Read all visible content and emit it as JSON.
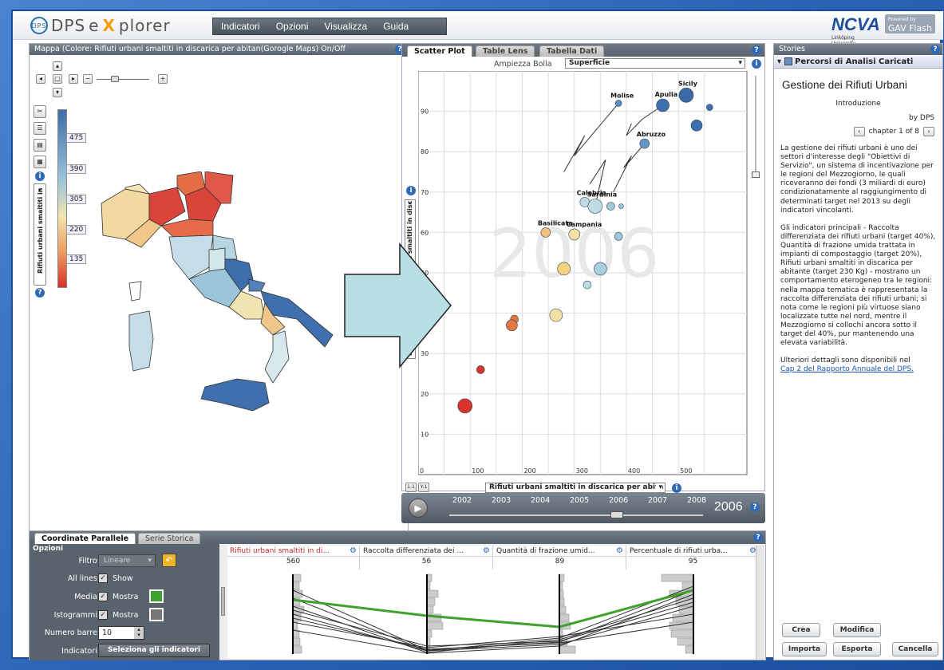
{
  "header": {
    "logo_prefix": "DPS",
    "logo_e": "e",
    "logo_x": "X",
    "logo_rest": "plorer",
    "menu": [
      "Indicatori",
      "Opzioni",
      "Visualizza",
      "Guida"
    ],
    "ncva": "NCVA",
    "ncva_sub": "Linköping University",
    "powered": "Powered by",
    "gav": "GAV Flash"
  },
  "map": {
    "title": "Mappa (Colore: Rifiuti urbani smaltiti in discarica per abitan(Gorogle Maps) On/Off",
    "legend_ticks": [
      "475",
      "390",
      "305",
      "220",
      "135"
    ],
    "legend_label": "Rifiuti urbani smaltiti in",
    "colors": {
      "high": "#3d6eaa",
      "mid": "#f2e4b0",
      "low": "#d7302a"
    }
  },
  "scatter": {
    "tabs": [
      "Scatter Plot",
      "Table Lens",
      "Tabella Dati"
    ],
    "bubble_label": "Ampiezza Bolla",
    "bubble_value": "Superficie",
    "year_watermark": "2006",
    "y_axis_label": "Percentuale di rifiuti urbani smaltiti in disc",
    "x_axis_label": "Rifiuti urbani smaltiti in discarica per abita",
    "y_ticks": [
      "90",
      "80",
      "70",
      "60",
      "50",
      "40",
      "30",
      "20",
      "10"
    ],
    "x_ticks": [
      "0",
      "100",
      "200",
      "300",
      "400",
      "500"
    ],
    "scale_buttons": [
      "1:1",
      "Y:1"
    ],
    "region_labels": [
      "Molise",
      "Sicily",
      "Apulia",
      "Abruzzo",
      "Calabria",
      "Sardinia",
      "Basilicata",
      "Campania"
    ]
  },
  "chart_data": {
    "type": "scatter",
    "title": "",
    "xlabel": "Rifiuti urbani smaltiti in discarica per abita",
    "ylabel": "Percentuale di rifiuti urbani smaltiti in disc",
    "xlim": [
      0,
      600
    ],
    "ylim": [
      0,
      100
    ],
    "year": "2006",
    "points": [
      {
        "label": "Molise",
        "x": 385,
        "y": 92,
        "r": 4,
        "color": "#5b8cc2"
      },
      {
        "label": "Sicily",
        "x": 515,
        "y": 94,
        "r": 9,
        "color": "#3a6aa8"
      },
      {
        "label": "Apulia",
        "x": 470,
        "y": 91.5,
        "r": 8,
        "color": "#3f6fac"
      },
      {
        "label": "",
        "x": 560,
        "y": 91,
        "r": 4,
        "color": "#3f6fac"
      },
      {
        "label": "",
        "x": 535,
        "y": 86.5,
        "r": 7,
        "color": "#3f6fac"
      },
      {
        "label": "Abruzzo",
        "x": 435,
        "y": 82,
        "r": 6,
        "color": "#6796c6"
      },
      {
        "label": "Calabria",
        "x": 320,
        "y": 67.5,
        "r": 6,
        "color": "#bfdbe4"
      },
      {
        "label": "Sardinia",
        "x": 340,
        "y": 66.5,
        "r": 9,
        "color": "#bfdbe4"
      },
      {
        "label": "",
        "x": 370,
        "y": 66.5,
        "r": 5,
        "color": "#9ec8d8"
      },
      {
        "label": "",
        "x": 390,
        "y": 66.5,
        "r": 3,
        "color": "#9ec8d8"
      },
      {
        "label": "Basilicata",
        "x": 245,
        "y": 60,
        "r": 6,
        "color": "#f2c07a"
      },
      {
        "label": "Campania",
        "x": 300,
        "y": 59.5,
        "r": 7,
        "color": "#f2e0a4"
      },
      {
        "label": "",
        "x": 385,
        "y": 59,
        "r": 5,
        "color": "#9ec8d8"
      },
      {
        "label": "",
        "x": 280,
        "y": 51,
        "r": 8,
        "color": "#f5d07f"
      },
      {
        "label": "",
        "x": 350,
        "y": 51,
        "r": 8,
        "color": "#a7d0dd"
      },
      {
        "label": "",
        "x": 325,
        "y": 47,
        "r": 5,
        "color": "#bfdbe4"
      },
      {
        "label": "",
        "x": 265,
        "y": 39.5,
        "r": 8,
        "color": "#f2dfa4"
      },
      {
        "label": "",
        "x": 185,
        "y": 38.5,
        "r": 5,
        "color": "#e37741"
      },
      {
        "label": "",
        "x": 180,
        "y": 37,
        "r": 7,
        "color": "#e37741"
      },
      {
        "label": "",
        "x": 120,
        "y": 26,
        "r": 5,
        "color": "#d9332b"
      },
      {
        "label": "",
        "x": 90,
        "y": 17,
        "r": 9,
        "color": "#d9332b"
      }
    ]
  },
  "timeline": {
    "years": [
      "2002",
      "2003",
      "2004",
      "2005",
      "2006",
      "2007",
      "2008"
    ],
    "current": "2006"
  },
  "stories": {
    "panel_title": "Stories",
    "header": "Percorsi di Analisi Caricati",
    "title": "Gestione dei Rifiuti Urbani",
    "intro": "Introduzione",
    "by": "by DPS",
    "chapter": "chapter 1 of 8",
    "para1": "La gestione dei rifiuti urbani è uno dei settori d'interesse degli \"Obiettivi di Servizio\", un sistema di incentivazione per le regioni del Mezzogiorno, le quali riceveranno dei fondi (3 miliardi di euro) condizionatamente al raggiungimento di determinati target nel 2013 su degli indicatori vincolanti.",
    "para2": "Gli indicatori principali - Raccolta differenziata dei rifiuti urbani (target 40%), Quantità di frazione umida trattata in impianti di compostaggio (target 20%), Rifiuti urbani smaltiti in discarica per abitante (target 230 Kg) - mostrano un comportamento eterogeneo tra le regioni: nella mappa tematica è rappresentata la raccolta differenziata dei rifiuti urbani; si nota come le regioni più virtuose siano localizzate tutte nel nord, mentre il Mezzogiorno si collochi ancora sotto il target del 40%, pur mantenendo una elevata variabilità.",
    "para3": "Ulteriori dettagli sono disponibili nel",
    "link": "Cap 2 del Rapporto Annuale del DPS.",
    "buttons": [
      "Crea",
      "Modifica",
      "Importa",
      "Esporta",
      "Cancella"
    ]
  },
  "bottom": {
    "tabs": [
      "Coordinate Parallele",
      "Serie Storica"
    ],
    "options_title": "Opzioni",
    "filtro_label": "Filtro:",
    "filtro_value": "Lineare",
    "all_lines_label": "All lines:",
    "all_lines_value": "Show",
    "media_label": "Media:",
    "media_value": "Mostra",
    "istogrammi_label": "Istogrammi:",
    "istogrammi_value": "Mostra",
    "barre_label": "Numero barre:",
    "barre_value": "10",
    "indicatori_label": "Indicatori:",
    "indicatori_button": "Seleziona gli indicatori",
    "axes": [
      {
        "name": "Rifiuti urbani smaltiti in di...",
        "max": "560",
        "color": "#c0282c"
      },
      {
        "name": "Raccolta differenziata dei ...",
        "max": "56",
        "color": "#222"
      },
      {
        "name": "Quantità di frazione umid...",
        "max": "89",
        "color": "#222"
      },
      {
        "name": "Percentuale di rifiuti urba...",
        "max": "95",
        "color": "#222"
      }
    ]
  }
}
